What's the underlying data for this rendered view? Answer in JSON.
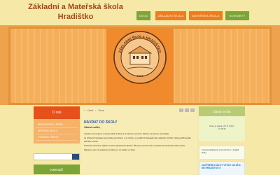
{
  "header": {
    "title_line1": "Základní a Mateřská škola",
    "title_line2": "Hradištko"
  },
  "nav": [
    {
      "label": "ÚVOD",
      "color": "#7ca537"
    },
    {
      "label": "ZÁKLADNÍ ŠKOLA",
      "color": "#ed7d1f"
    },
    {
      "label": "MATEŘSKÁ ŠKOLA",
      "color": "#ed7d1f"
    },
    {
      "label": "KONTAKTY",
      "color": "#7ca537"
    }
  ],
  "seal": {
    "text": "ZÁKLADNÍ ŠKOLA HRADIŠTKO",
    "year": "1926"
  },
  "sidebar_left": {
    "heading": "O nás",
    "items": [
      "PEDAGOGICKÝ SBOR",
      "HISTORIE ŠKOLY",
      "VÝSLEDKY ŠKOLY"
    ],
    "calendar_heading": "Kalendář"
  },
  "breadcrumb": {
    "home": "Úvod",
    "current": "Úvod"
  },
  "article": {
    "title": "NÁVRAT DO ŠKOLY",
    "subtitle": "Vážení rodiče,",
    "body": [
      "posíláme vám pokyny k návratu žáků do školy a ke školnímu provozu. Pečlivě si je prosím prostudujte.",
      "Ve středu 18. listopadu se do školy vrací žáci 1. a 2. ročníku, v pondělí 30. listopadu žáci ostatních ročníků. Výuka probíhá podle běžného rozvrhu.",
      "Podrobné informace najdete na webu Ministerstva školství. Žáci jsou povinni nosit ve společných prostorách školy roušku.",
      "Děkujeme vám za spolupráci a těšíme se na setkání ve škole."
    ]
  },
  "sidebar_right": {
    "date_heading": "Datum a čas",
    "date_line1": "Dnes je pátek, 20. 8. 2021,",
    "date_line2": "17:15:37",
    "notice": "Kroužek Akademie v kroužcích a v kvalitě školy",
    "promo_title": "CLEPSEMI KVALITY VÝUKY NA ZŠ A MŠ HRADIŠTKO II"
  },
  "colors": {
    "title": "#a4461a",
    "nav_green": "#7ca537",
    "nav_orange": "#ed7d1f",
    "banner": "#f08a2c",
    "sidebar_head": "#e5501b",
    "link": "#2d5c9e"
  }
}
